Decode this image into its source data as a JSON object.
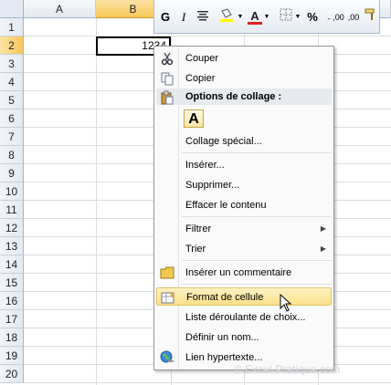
{
  "sheet": {
    "columns": [
      "A",
      "B"
    ],
    "rows": [
      "1",
      "2",
      "3",
      "4",
      "5",
      "6",
      "7",
      "8",
      "9",
      "10",
      "11",
      "12",
      "13",
      "14",
      "15",
      "16",
      "17",
      "18",
      "19",
      "20"
    ],
    "selected_column": "B",
    "selected_row": "2",
    "active_cell_value": "1234"
  },
  "minibar": {
    "bold": "G",
    "italic": "I",
    "align_icon": "align-center-icon",
    "fill_icon": "fill-color-icon",
    "font_color": "A",
    "borders_icon": "borders-icon",
    "percent": "%",
    "increase_decimal": ",00",
    "decrease_decimal": ",00",
    "format_painter_icon": "format-painter-icon"
  },
  "menu": {
    "cut": "Couper",
    "copy": "Copier",
    "paste_options": "Options de collage :",
    "paste_button": "A",
    "paste_special": "Collage spécial...",
    "insert": "Insérer...",
    "delete": "Supprimer...",
    "clear": "Effacer le contenu",
    "filter": "Filtrer",
    "sort": "Trier",
    "insert_comment": "Insérer un commentaire",
    "format_cells": "Format de cellule",
    "dropdown_list": "Liste déroulante de choix...",
    "define_name": "Définir un nom...",
    "hyperlink": "Lien hypertexte..."
  },
  "watermark": "© Excel-Pratique.com",
  "colors": {
    "highlight": "#fbe08a",
    "selected_header": "#f8c857",
    "menu_border": "#979797"
  }
}
